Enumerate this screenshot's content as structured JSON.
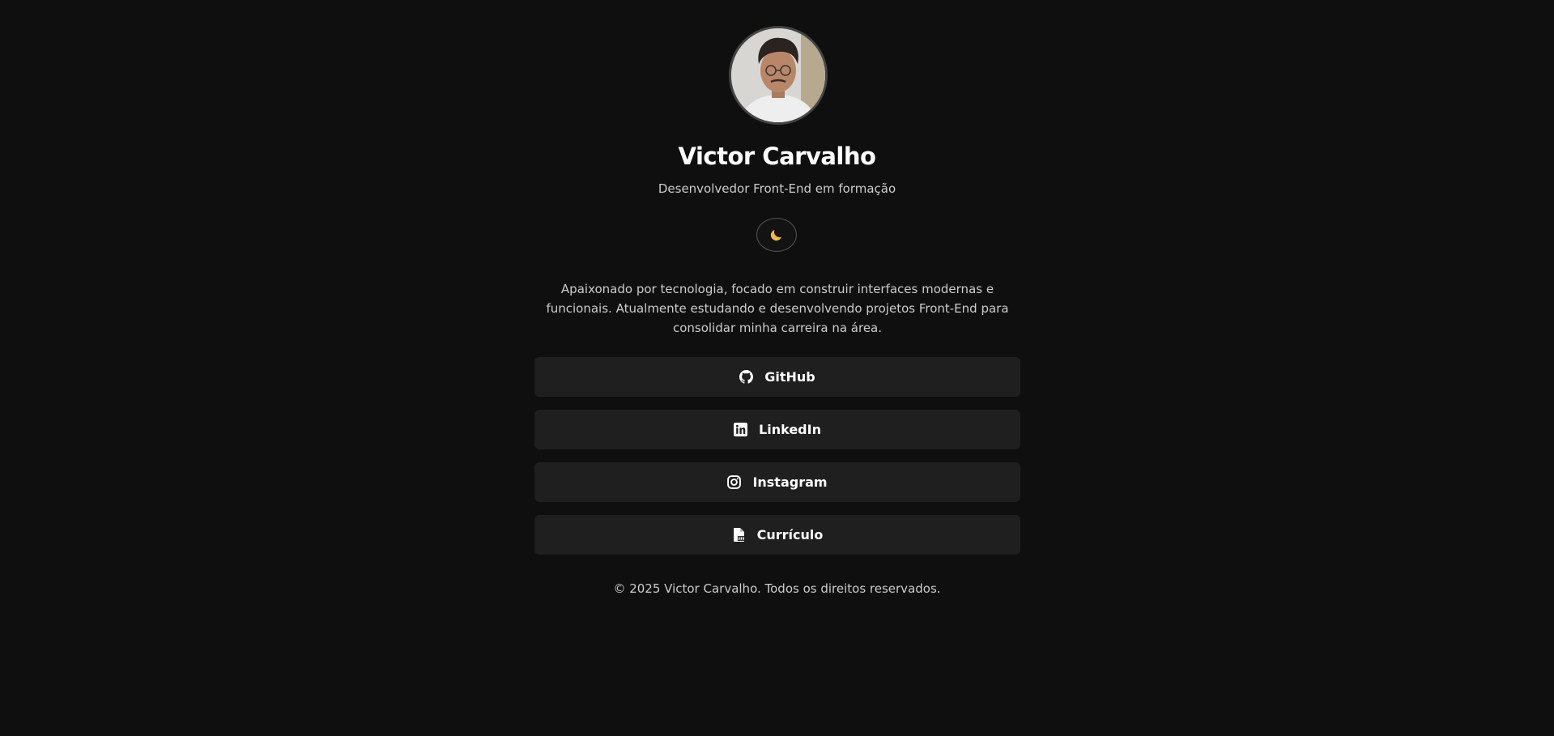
{
  "profile": {
    "name": "Victor Carvalho",
    "role": "Desenvolvedor Front-End em formação",
    "avatar_icon": "profile-photo"
  },
  "theme_toggle": {
    "icon": "moon-icon",
    "icon_color": "#f5b84a"
  },
  "bio": "Apaixonado por tecnologia, focado em construir interfaces modernas e funcionais. Atualmente estudando e desenvolvendo projetos Front-End para consolidar minha carreira na área.",
  "links": [
    {
      "label": "GitHub",
      "icon": "github-icon"
    },
    {
      "label": "LinkedIn",
      "icon": "linkedin-icon"
    },
    {
      "label": "Instagram",
      "icon": "instagram-icon"
    },
    {
      "label": "Currículo",
      "icon": "pdf-file-icon"
    }
  ],
  "footer": "© 2025 Victor Carvalho. Todos os direitos reservados.",
  "colors": {
    "background": "#0f0f0f",
    "button_background": "#1f1f1f",
    "text": "#ffffff",
    "muted_text": "#cccccc"
  }
}
